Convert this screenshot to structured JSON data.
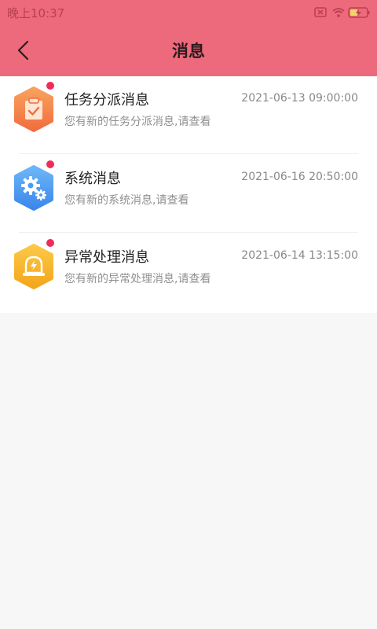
{
  "status_bar": {
    "time": "晚上10:37",
    "icons": [
      "sim-icon",
      "wifi-icon",
      "battery-charging-icon"
    ]
  },
  "header": {
    "title": "消息",
    "back_icon": "chevron-left-icon",
    "background_color": "#ec6a7b"
  },
  "messages": [
    {
      "title": "任务分派消息",
      "time": "2021-06-13 09:00:00",
      "description": "您有新的任务分派消息,请查看",
      "icon": "clipboard-check-icon",
      "icon_color": "#f5824c",
      "unread": true
    },
    {
      "title": "系统消息",
      "time": "2021-06-16 20:50:00",
      "description": "您有新的系统消息,请查看",
      "icon": "gear-icon",
      "icon_color": "#4b9cf2",
      "unread": true
    },
    {
      "title": "异常处理消息",
      "time": "2021-06-14 13:15:00",
      "description": "您有新的异常处理消息,请查看",
      "icon": "alarm-light-icon",
      "icon_color": "#f6b223",
      "unread": true
    }
  ]
}
